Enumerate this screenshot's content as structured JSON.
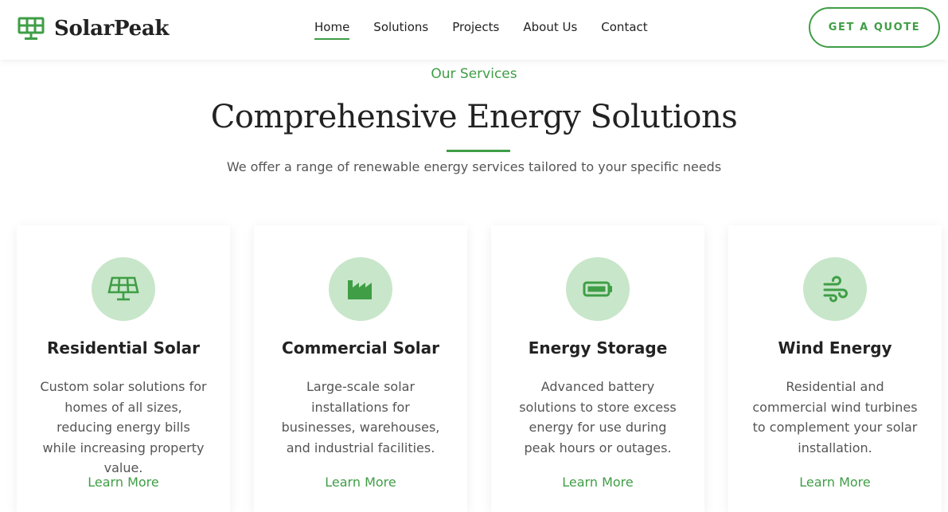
{
  "brand": {
    "name": "SolarPeak",
    "icon": "solar-panel-icon",
    "accent": "#3f9e46"
  },
  "nav": {
    "items": [
      {
        "label": "Home",
        "active": true
      },
      {
        "label": "Solutions",
        "active": false
      },
      {
        "label": "Projects",
        "active": false
      },
      {
        "label": "About Us",
        "active": false
      },
      {
        "label": "Contact",
        "active": false
      }
    ],
    "cta_label": "GET A QUOTE"
  },
  "services": {
    "eyebrow": "Our Services",
    "title": "Comprehensive Energy Solutions",
    "subtitle": "We offer a range of renewable energy services tailored to your specific needs",
    "cards": [
      {
        "icon": "solar-panel-icon",
        "title": "Residential Solar",
        "description": "Custom solar solutions for homes of all sizes, reducing energy bills while increasing property value.",
        "link": "Learn More"
      },
      {
        "icon": "industry-icon",
        "title": "Commercial Solar",
        "description": "Large-scale solar installations for businesses, warehouses, and industrial facilities.",
        "link": "Learn More"
      },
      {
        "icon": "battery-icon",
        "title": "Energy Storage",
        "description": "Advanced battery solutions to store excess energy for use during peak hours or outages.",
        "link": "Learn More"
      },
      {
        "icon": "wind-icon",
        "title": "Wind Energy",
        "description": "Residential and commercial wind turbines to complement your solar installation.",
        "link": "Learn More"
      }
    ],
    "icon_circle_color": "#c8e6c9"
  }
}
